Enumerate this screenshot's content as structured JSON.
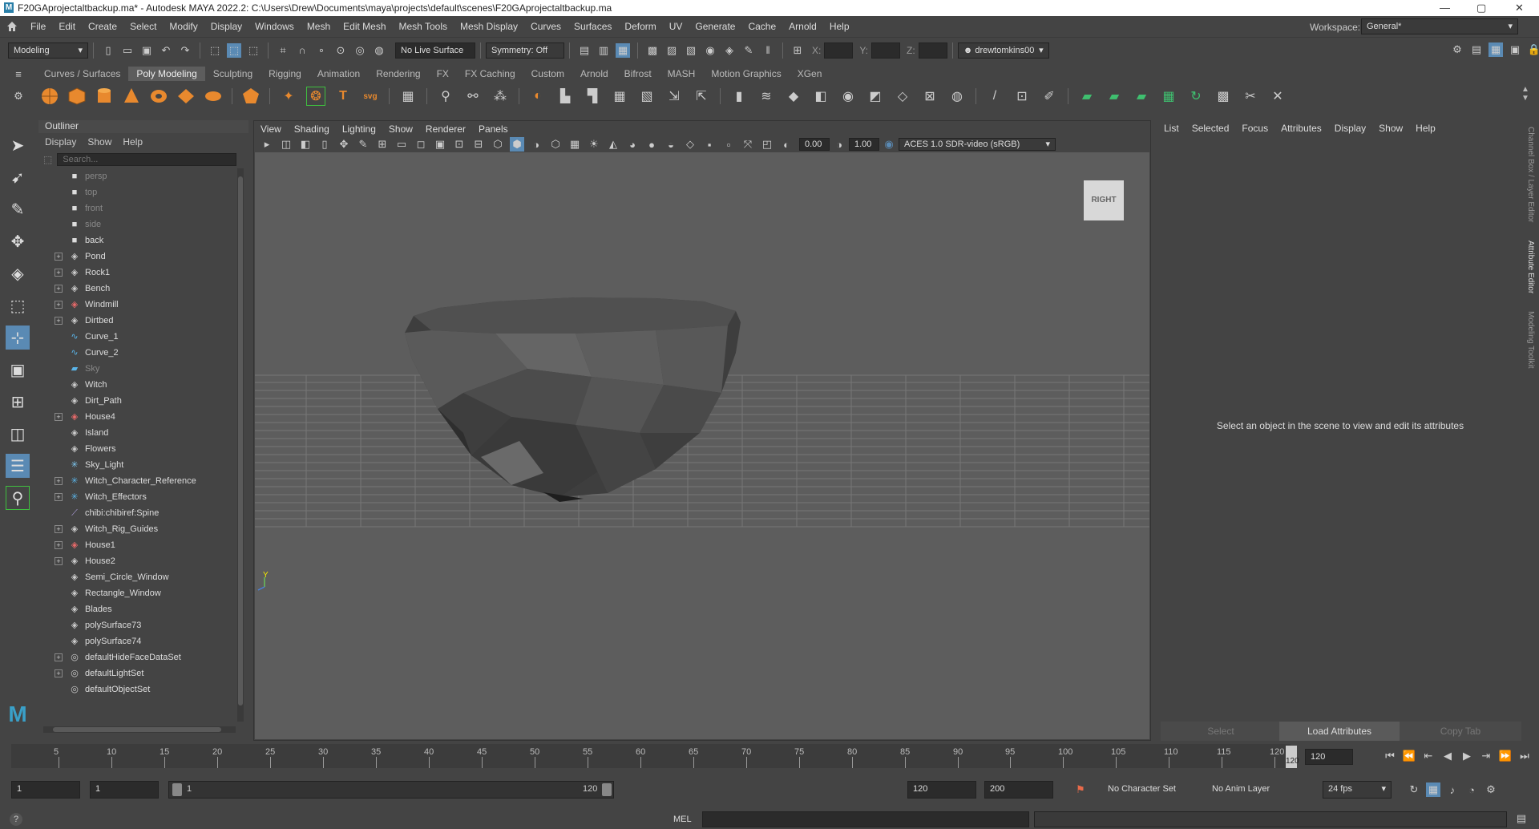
{
  "window": {
    "title": "F20GAprojectaltbackup.ma* - Autodesk MAYA 2022.2: C:\\Users\\Drew\\Documents\\maya\\projects\\default\\scenes\\F20GAprojectaltbackup.ma",
    "logo_letter": "M",
    "min": "—",
    "max": "▢",
    "close": "✕"
  },
  "menubar": {
    "items": [
      "File",
      "Edit",
      "Create",
      "Select",
      "Modify",
      "Display",
      "Windows",
      "Mesh",
      "Edit Mesh",
      "Mesh Tools",
      "Mesh Display",
      "Curves",
      "Surfaces",
      "Deform",
      "UV",
      "Generate",
      "Cache",
      "Arnold",
      "Help"
    ],
    "workspace_label": "Workspace:",
    "workspace_value": "General*"
  },
  "statusline": {
    "mode": "Modeling",
    "live_surface": "No Live Surface",
    "symmetry": "Symmetry: Off",
    "x_label": "X:",
    "y_label": "Y:",
    "z_label": "Z:",
    "user": "drewtomkins00"
  },
  "shelf": {
    "tabs": [
      "Curves / Surfaces",
      "Poly Modeling",
      "Sculpting",
      "Rigging",
      "Animation",
      "Rendering",
      "FX",
      "FX Caching",
      "Custom",
      "Arnold",
      "Bifrost",
      "MASH",
      "Motion Graphics",
      "XGen"
    ],
    "active_tab": "Poly Modeling"
  },
  "outliner": {
    "title": "Outliner",
    "menus": [
      "Display",
      "Show",
      "Help"
    ],
    "search_placeholder": "Search...",
    "items": [
      {
        "name": "persp",
        "icon": "camera-icon",
        "expand": false,
        "dim": true
      },
      {
        "name": "top",
        "icon": "camera-icon",
        "expand": false,
        "dim": true
      },
      {
        "name": "front",
        "icon": "camera-icon",
        "expand": false,
        "dim": true
      },
      {
        "name": "side",
        "icon": "camera-icon",
        "expand": false,
        "dim": true
      },
      {
        "name": "back",
        "icon": "camera-icon",
        "expand": false,
        "dim": false
      },
      {
        "name": "Pond",
        "icon": "transform-icon",
        "expand": true,
        "dim": false
      },
      {
        "name": "Rock1",
        "icon": "transform-icon",
        "expand": true,
        "dim": false
      },
      {
        "name": "Bench",
        "icon": "transform-icon",
        "expand": true,
        "dim": false
      },
      {
        "name": "Windmill",
        "icon": "mesh-red-icon",
        "expand": true,
        "dim": false
      },
      {
        "name": "Dirtbed",
        "icon": "transform-icon",
        "expand": true,
        "dim": false
      },
      {
        "name": "Curve_1",
        "icon": "curve-icon",
        "expand": false,
        "dim": false
      },
      {
        "name": "Curve_2",
        "icon": "curve-icon",
        "expand": false,
        "dim": false
      },
      {
        "name": "Sky",
        "icon": "surface-icon",
        "expand": false,
        "dim": true
      },
      {
        "name": "Witch",
        "icon": "transform-icon",
        "expand": false,
        "dim": false
      },
      {
        "name": "Dirt_Path",
        "icon": "transform-icon",
        "expand": false,
        "dim": false
      },
      {
        "name": "House4",
        "icon": "mesh-red-icon",
        "expand": true,
        "dim": false
      },
      {
        "name": "Island",
        "icon": "transform-icon",
        "expand": false,
        "dim": false
      },
      {
        "name": "Flowers",
        "icon": "transform-icon",
        "expand": false,
        "dim": false
      },
      {
        "name": "Sky_Light",
        "icon": "light-icon",
        "expand": false,
        "dim": false
      },
      {
        "name": "Witch_Character_Reference",
        "icon": "joint-icon",
        "expand": true,
        "dim": false
      },
      {
        "name": "Witch_Effectors",
        "icon": "joint-icon",
        "expand": true,
        "dim": false
      },
      {
        "name": "chibi:chibiref:Spine",
        "icon": "spine-icon",
        "expand": false,
        "dim": false
      },
      {
        "name": "Witch_Rig_Guides",
        "icon": "transform-icon",
        "expand": true,
        "dim": false
      },
      {
        "name": "House1",
        "icon": "mesh-red-icon",
        "expand": true,
        "dim": false
      },
      {
        "name": "House2",
        "icon": "transform-icon",
        "expand": true,
        "dim": false
      },
      {
        "name": "Semi_Circle_Window",
        "icon": "transform-icon",
        "expand": false,
        "dim": false
      },
      {
        "name": "Rectangle_Window",
        "icon": "transform-icon",
        "expand": false,
        "dim": false
      },
      {
        "name": "Blades",
        "icon": "transform-icon",
        "expand": false,
        "dim": false
      },
      {
        "name": "polySurface73",
        "icon": "transform-icon",
        "expand": false,
        "dim": false
      },
      {
        "name": "polySurface74",
        "icon": "transform-icon",
        "expand": false,
        "dim": false
      },
      {
        "name": "defaultHideFaceDataSet",
        "icon": "set-icon",
        "expand": true,
        "dim": false
      },
      {
        "name": "defaultLightSet",
        "icon": "set-icon",
        "expand": true,
        "dim": false
      },
      {
        "name": "defaultObjectSet",
        "icon": "set-icon",
        "expand": false,
        "dim": false
      }
    ]
  },
  "viewport": {
    "menus": [
      "View",
      "Shading",
      "Lighting",
      "Show",
      "Renderer",
      "Panels"
    ],
    "exposure": "0.00",
    "gamma": "1.00",
    "color_space": "ACES 1.0 SDR-video (sRGB)",
    "viewcube_label": "RIGHT",
    "axis_label": "Y"
  },
  "attribute_editor": {
    "menus": [
      "List",
      "Selected",
      "Focus",
      "Attributes",
      "Display",
      "Show",
      "Help"
    ],
    "message": "Select an object in the scene to view and edit its attributes",
    "buttons": {
      "select": "Select",
      "load": "Load Attributes",
      "copy": "Copy Tab"
    }
  },
  "side_tabs": [
    "Channel Box / Layer Editor",
    "Attribute Editor",
    "Modeling Toolkit"
  ],
  "timeslider": {
    "ticks": [
      "5",
      "10",
      "15",
      "20",
      "25",
      "30",
      "35",
      "40",
      "45",
      "50",
      "55",
      "60",
      "65",
      "70",
      "75",
      "80",
      "85",
      "90",
      "95",
      "100",
      "105",
      "110",
      "115",
      "120"
    ],
    "current_frame_marker": "120",
    "current_frame": "120"
  },
  "range": {
    "start": "1",
    "anim_start": "1",
    "slider_start": "1",
    "slider_end": "120",
    "end": "120",
    "anim_end": "200",
    "character_set": "No Character Set",
    "anim_layer": "No Anim Layer",
    "fps": "24 fps"
  },
  "helpline": {
    "mel_label": "MEL",
    "help_icon": "?"
  }
}
